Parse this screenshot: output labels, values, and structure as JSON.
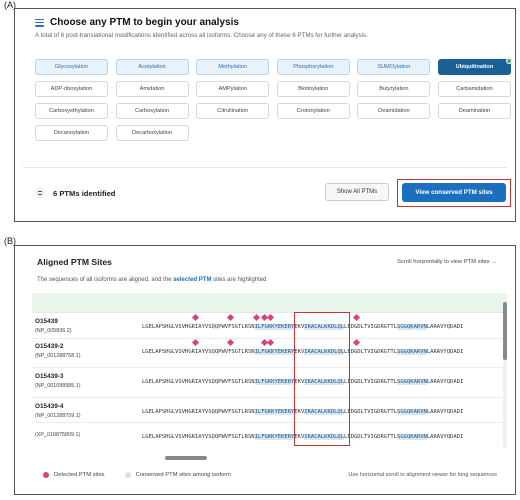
{
  "labels": {
    "a": "(A)",
    "b": "(B)"
  },
  "selector": {
    "title": "Choose any PTM to begin your analysis",
    "subtitle": "A total of 6 post-translational modifications identified across all isoforms. Choose any of these 6 PTMs for further analysis.",
    "chips": [
      {
        "label": "Glycosylation",
        "state": "highlight"
      },
      {
        "label": "Acetylation",
        "state": "highlight"
      },
      {
        "label": "Methylation",
        "state": "highlight"
      },
      {
        "label": "Phosphorylation",
        "state": "highlight"
      },
      {
        "label": "SUMOylation",
        "state": "highlight"
      },
      {
        "label": "Ubiquitination",
        "state": "selected"
      },
      {
        "label": "ADP-ribosylation",
        "state": "normal"
      },
      {
        "label": "Amidation",
        "state": "normal"
      },
      {
        "label": "AMPylation",
        "state": "normal"
      },
      {
        "label": "Biotinylation",
        "state": "normal"
      },
      {
        "label": "Butyrylation",
        "state": "normal"
      },
      {
        "label": "Carbamidation",
        "state": "normal"
      },
      {
        "label": "Carboxyethylation",
        "state": "normal"
      },
      {
        "label": "Carboxylation",
        "state": "normal"
      },
      {
        "label": "Citrullination",
        "state": "normal"
      },
      {
        "label": "Crotonylation",
        "state": "normal"
      },
      {
        "label": "Deamidation",
        "state": "normal"
      },
      {
        "label": "Deamination",
        "state": "normal"
      },
      {
        "label": "Decanoylation",
        "state": "normal"
      },
      {
        "label": "Decarboxylation",
        "state": "normal"
      }
    ],
    "count_label": "6 PTMs identified",
    "show_all_label": "Show All PTMs",
    "conserved_label": "View conserved PTM sites"
  },
  "aligned": {
    "title": "Aligned PTM Sites",
    "scroll_hint": "Scroll horizontally to view PTM sites →",
    "subtitle_pre": "The sequences of all isoforms are aligned, and the ",
    "subtitle_sel": "selected PTM",
    "subtitle_post": " sites are highlighted",
    "rows": [
      {
        "id": "O15439",
        "acc": "(NP_005836.2)"
      },
      {
        "id": "O15439-2",
        "acc": "(NP_001288758.1)"
      },
      {
        "id": "O15439-3",
        "acc": "(NP_001098985.1)"
      },
      {
        "id": "O15439-4",
        "acc": "(NP_001288759.1)"
      },
      {
        "id": "",
        "acc": "(XP_016875809.1)"
      }
    ],
    "seq": {
      "a": "LGELAPSHGLVSVHGRIAYVSQQPWVFSGTLRSN",
      "c1": "ILFGKKYEKERY",
      "b": "EKV",
      "c2": "IKACALKKDLQL",
      "d": "LEDGDLTVIGDRGTTL",
      "c3": "SGGQKARVN",
      "e": "LARAVYQDADI"
    },
    "legend_detected": "Detected PTM sites",
    "legend_conserved": "Conserved PTM sites among isoform",
    "legend_note": "Use horizontal scroll in alignment viewer for long sequences",
    "colors": {
      "detected": "#d6457a",
      "conserved": "#cfe3f3"
    }
  }
}
